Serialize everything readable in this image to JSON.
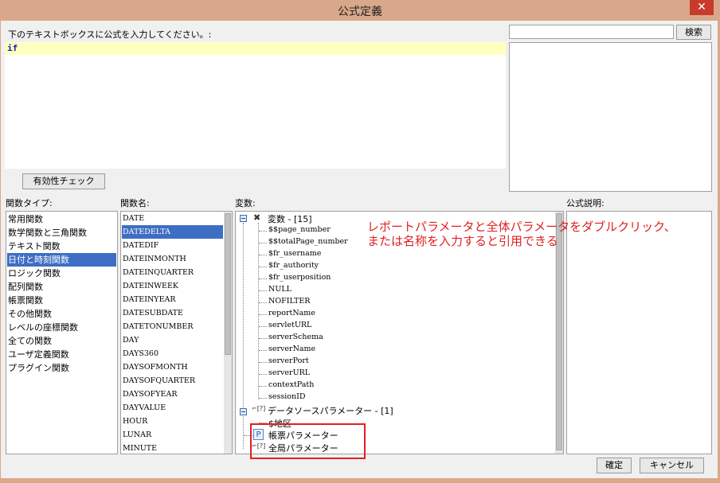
{
  "window": {
    "title": "公式定義",
    "close": "✕"
  },
  "formula": {
    "prompt": "下のテキストボックスに公式を入力してください。:",
    "text": "if",
    "validate_label": "有効性チェック"
  },
  "search": {
    "value": "",
    "button_label": "検索"
  },
  "labels": {
    "func_type": "関数タイプ:",
    "func_name": "関数名:",
    "variables": "変数:",
    "description": "公式説明:"
  },
  "func_types": [
    "常用関数",
    "数学関数と三角関数",
    "テキスト関数",
    "日付と時刻関数",
    "ロジック関数",
    "配列関数",
    "帳票関数",
    "その他関数",
    "レベルの座標関数",
    "全ての関数",
    "ユーザ定義関数",
    "プラグイン関数"
  ],
  "func_type_selected": "日付と時刻関数",
  "func_names": [
    "DATE",
    "DATEDELTA",
    "DATEDIF",
    "DATEINMONTH",
    "DATEINQUARTER",
    "DATEINWEEK",
    "DATEINYEAR",
    "DATESUBDATE",
    "DATETONUMBER",
    "DAY",
    "DAYS360",
    "DAYSOFMONTH",
    "DAYSOFQUARTER",
    "DAYSOFYEAR",
    "DAYVALUE",
    "HOUR",
    "LUNAR",
    "MINUTE"
  ],
  "func_name_selected": "DATEDELTA",
  "variables": {
    "root_label": "変数 - [15]",
    "items": [
      "$$page_number",
      "$$totalPage_number",
      "$fr_username",
      "$fr_authority",
      "$fr_userposition",
      "NULL",
      "NOFILTER",
      "reportName",
      "servletURL",
      "serverSchema",
      "serverName",
      "serverPort",
      "serverURL",
      "contextPath",
      "sessionID"
    ],
    "datasource_label": "データソースパラメーター - [1]",
    "datasource_items": [
      "$地区"
    ],
    "report_param_label": "帳票パラメーター",
    "global_param_label": "全局パラメーター"
  },
  "annotation": {
    "line1": "レポートパラメータと全体パラメータをダブルクリック、",
    "line2": "または名称を入力すると引用できる"
  },
  "footer": {
    "ok_label": "確定",
    "cancel_label": "キャンセル"
  },
  "colors": {
    "selection": "#3e6ec4",
    "annotation": "#e02020",
    "editor_highlight": "#ffffc0",
    "title_bar": "#d9a789"
  }
}
